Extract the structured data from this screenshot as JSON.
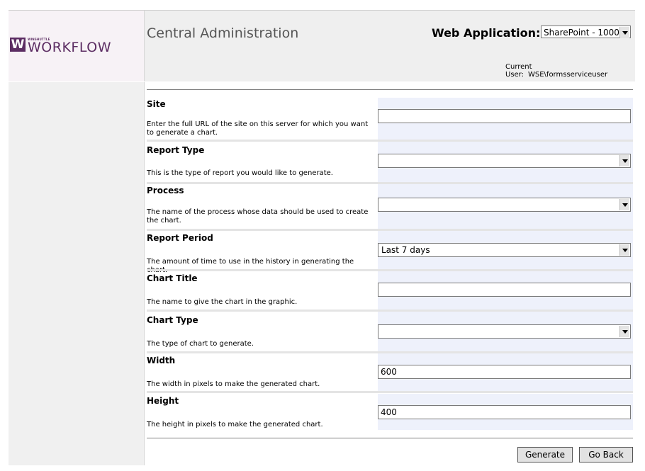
{
  "logo": {
    "small_text": "WINSHUTTLE",
    "big_text": "WORKFLOW",
    "mark": "W"
  },
  "header": {
    "title": "Central Administration",
    "web_app_label": "Web Application:",
    "web_app_value": "SharePoint - 1000",
    "current_user_label": "Current User:",
    "current_user_value": "WSE\\formsserviceuser"
  },
  "sections": [
    {
      "label": "Site",
      "desc": "Enter the full URL of the site on this server for which you want to generate a chart.",
      "value": ""
    },
    {
      "label": "Report Type",
      "desc": "This is the type of report you would like to generate.",
      "value": ""
    },
    {
      "label": "Process",
      "desc": "The name of the process whose data should be used to create the chart.",
      "value": ""
    },
    {
      "label": "Report Period",
      "desc": "The amount of time to use in the history in generating the chart.",
      "value": "Last 7 days"
    },
    {
      "label": "Chart Title",
      "desc": "The name to give the chart in the graphic.",
      "value": ""
    },
    {
      "label": "Chart Type",
      "desc": "The type of chart to generate.",
      "value": ""
    },
    {
      "label": "Width",
      "desc": "The width in pixels to make the generated chart.",
      "value": "600"
    },
    {
      "label": "Height",
      "desc": "The height in pixels to make the generated chart.",
      "value": "400"
    }
  ],
  "buttons": {
    "generate": "Generate",
    "go_back": "Go Back"
  },
  "colors": {
    "brand": "#5c2d63",
    "field_bg": "#eef1fb",
    "header_bg": "#efefef",
    "sidebar_bg": "#f0f0f0"
  }
}
